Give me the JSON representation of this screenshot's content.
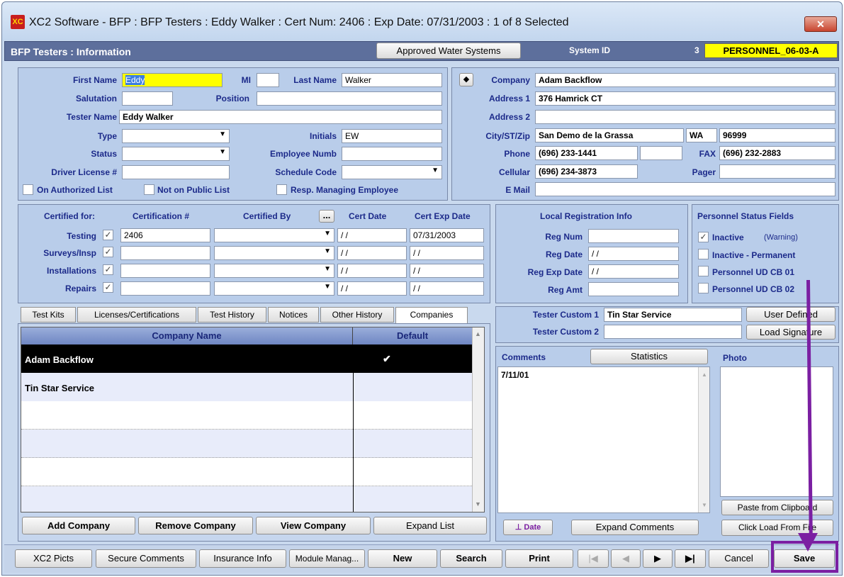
{
  "window": {
    "title": "XC2 Software - BFP : BFP Testers : Eddy Walker : Cert Num: 2406 : Exp Date: 07/31/2003 : 1 of 8 Selected",
    "app_icon_text": "XC",
    "close_label": "✕"
  },
  "header": {
    "title": "BFP Testers : Information",
    "approved_btn": "Approved Water Systems",
    "system_id_label": "System ID",
    "system_id_value": "3",
    "personnel_code": "PERSONNEL_06-03-A"
  },
  "person": {
    "first_name_label": "First Name",
    "first_name": "Eddy",
    "mi_label": "MI",
    "mi": "",
    "last_name_label": "Last Name",
    "last_name": "Walker",
    "salutation_label": "Salutation",
    "salutation": "",
    "position_label": "Position",
    "position": "",
    "tester_name_label": "Tester Name",
    "tester_name": "Eddy Walker",
    "type_label": "Type",
    "type": "",
    "initials_label": "Initials",
    "initials": "EW",
    "status_label": "Status",
    "status": "",
    "employee_numb_label": "Employee Numb",
    "employee_numb": "",
    "driver_license_label": "Driver License #",
    "driver_license": "",
    "schedule_code_label": "Schedule Code",
    "schedule_code": "",
    "on_authorized_list": "On Authorized List",
    "not_on_public_list": "Not on Public List",
    "resp_managing": "Resp. Managing Employee"
  },
  "company": {
    "company_label": "Company",
    "company": "Adam Backflow",
    "address1_label": "Address 1",
    "address1": "376 Hamrick CT",
    "address2_label": "Address 2",
    "address2": "",
    "citystzip_label": "City/ST/Zip",
    "city": "San Demo de la Grassa",
    "state": "WA",
    "zip": "96999",
    "phone_label": "Phone",
    "phone": "(696) 233-1441",
    "phone_ext": "",
    "fax_label": "FAX",
    "fax": "(696) 232-2883",
    "cellular_label": "Cellular",
    "cellular": "(696) 234-3873",
    "pager_label": "Pager",
    "pager": "",
    "email_label": "E Mail",
    "email": ""
  },
  "cert": {
    "certified_for": "Certified for:",
    "cert_num_hdr": "Certification #",
    "certified_by_hdr": "Certified By",
    "ellipsis": "...",
    "cert_date_hdr": "Cert Date",
    "cert_exp_hdr": "Cert Exp Date",
    "rows": [
      {
        "label": "Testing",
        "check": "✓",
        "num": "2406",
        "date": " /  /",
        "exp": "07/31/2003"
      },
      {
        "label": "Surveys/Insp",
        "check": "✓",
        "num": "",
        "date": " /  /",
        "exp": " /  /"
      },
      {
        "label": "Installations",
        "check": "✓",
        "num": "",
        "date": " /  /",
        "exp": " /  /"
      },
      {
        "label": "Repairs",
        "check": "✓",
        "num": "",
        "date": " /  /",
        "exp": " /  /"
      }
    ]
  },
  "localreg": {
    "title": "Local Registration Info",
    "reg_num_label": "Reg Num",
    "reg_num": "",
    "reg_date_label": "Reg Date",
    "reg_date": " /  /",
    "reg_exp_label": "Reg Exp Date",
    "reg_exp": " /  /",
    "reg_amt_label": "Reg Amt",
    "reg_amt": ""
  },
  "personnel_status": {
    "title": "Personnel Status Fields",
    "inactive": "Inactive",
    "warning": "(Warning)",
    "inactive_perm": "Inactive - Permanent",
    "ud1": "Personnel UD CB 01",
    "ud2": "Personnel UD CB 02",
    "check": "✓"
  },
  "tabs": [
    "Test Kits",
    "Licenses/Certifications",
    "Test History",
    "Notices",
    "Other History",
    "Companies"
  ],
  "companies_grid": {
    "col_name": "Company Name",
    "col_default": "Default",
    "rows": [
      {
        "name": "Adam Backflow",
        "default": "✔"
      },
      {
        "name": "Tin Star Service",
        "default": ""
      }
    ],
    "buttons": {
      "add": "Add Company",
      "remove": "Remove Company",
      "view": "View Company",
      "expand": "Expand List"
    }
  },
  "custom": {
    "custom1_label": "Tester Custom 1",
    "custom1": "Tin Star Service",
    "custom2_label": "Tester Custom 2",
    "custom2": "",
    "user_defined": "User Defined",
    "load_signature": "Load Signature"
  },
  "comments": {
    "label": "Comments",
    "statistics": "Statistics",
    "photo": "Photo",
    "text": "7/11/01",
    "date_btn": "Date",
    "expand": "Expand Comments",
    "paste": "Paste from Clipboard",
    "click_load": "Click Load From File"
  },
  "toolbar": {
    "pics": "XC2 Picts",
    "secure": "Secure Comments",
    "insurance": "Insurance Info",
    "module": "Module Manag...",
    "new": "New",
    "search": "Search",
    "print": "Print",
    "first": "|◀",
    "prev": "◀",
    "next": "▶",
    "last": "▶|",
    "cancel": "Cancel",
    "save": "Save"
  },
  "colors": {
    "accent": "#5d6f9c",
    "highlight": "#ffff00",
    "annotation": "#7b1fa2"
  }
}
